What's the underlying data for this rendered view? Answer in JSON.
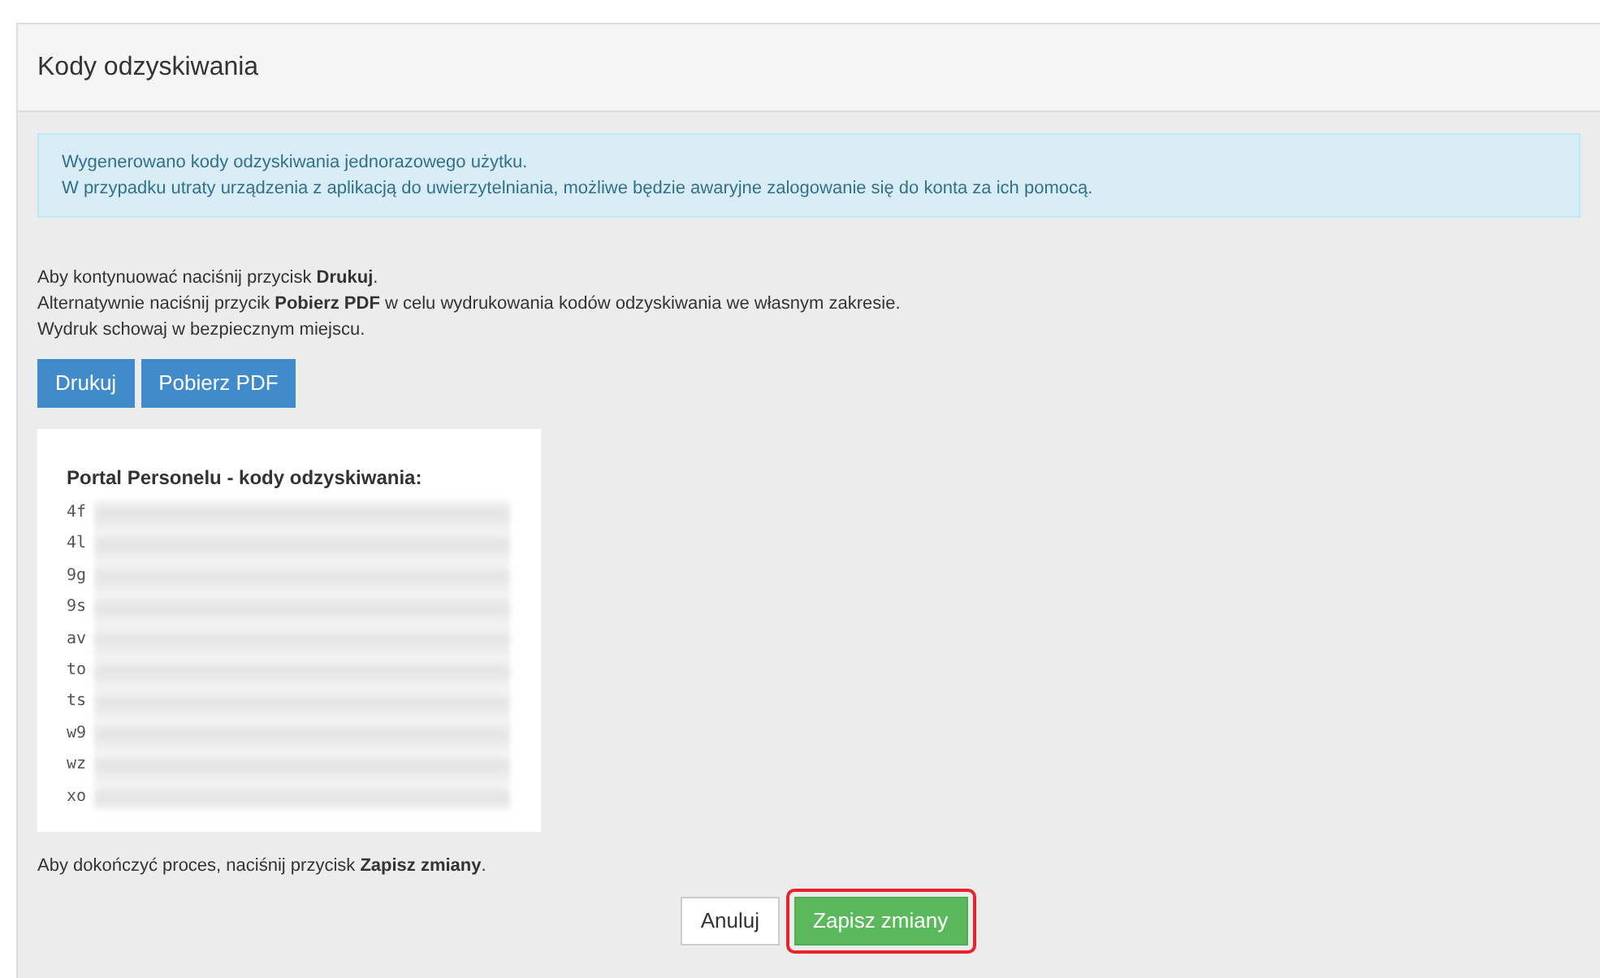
{
  "panel": {
    "title": "Kody odzyskiwania"
  },
  "alert": {
    "lines": [
      "Wygenerowano kody odzyskiwania jednorazowego użytku.",
      "W przypadku utraty urządzenia z aplikacją do uwierzytelniania, możliwe będzie awaryjne zalogowanie się do konta za ich pomocą."
    ]
  },
  "instructions": [
    "Aby kontynuować naciśnij przycisk **Drukuj**.",
    "Alternatywnie naciśnij przycik **Pobierz PDF** w celu wydrukowania kodów odzyskiwania we własnym zakresie.",
    "Wydruk schowaj w bezpiecznym miejscu."
  ],
  "print_buttons": [
    "Drukuj",
    "Pobierz PDF"
  ],
  "codes_card": {
    "title": "Portal Personelu - kody odzyskiwania:",
    "codes": [
      "4f",
      "4l",
      "9g",
      "9s",
      "av",
      "to",
      "ts",
      "w9",
      "wz",
      "xo"
    ]
  },
  "finish_text": "Aby dokończyć proces, naciśnij przycisk **Zapisz zmiany**.",
  "actions": [
    {
      "label": "Anuluj",
      "kind": "default",
      "highlighted": false
    },
    {
      "label": "Zapisz zmiany",
      "kind": "success",
      "highlighted": true
    }
  ]
}
